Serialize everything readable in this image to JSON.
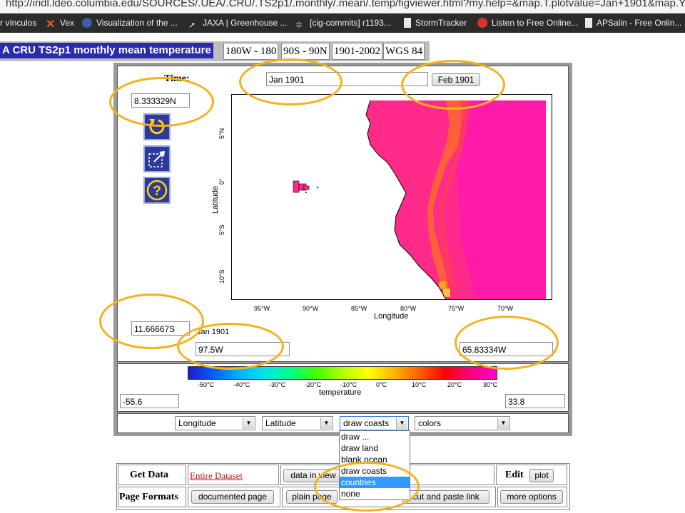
{
  "browser": {
    "url": "http://iridl.ldeo.columbia.edu/SOURCES/.UEA/.CRU/.TS2p1/.monthly/.mean/.temp/figviewer.html?my.help=&map.T.plotvalue=Jan+1901&map.Y",
    "bookmarks": [
      {
        "label": "r vínculos",
        "icon_color": ""
      },
      {
        "label": "Vex",
        "icon_color": "#e25d1b"
      },
      {
        "label": "Visualization of the ...",
        "icon_color": "#3a5ea8"
      },
      {
        "label": "JAXA | Greenhouse ...",
        "icon_color": "#c8c8c8"
      },
      {
        "label": "[cig-commits] r1193...",
        "icon_color": "#8da0c0"
      },
      {
        "label": "StormTracker",
        "icon_color": "#e8e8e8"
      },
      {
        "label": "Listen to Free Online...",
        "icon_color": "#d8322c"
      },
      {
        "label": "APSalin - Free Onlin...",
        "icon_color": "#e8e8e8"
      }
    ]
  },
  "header": {
    "dataset_title": "A CRU TS2p1 monthly mean temperature",
    "cells": [
      "180W - 180",
      "90S - 90N",
      "1901-2002",
      "WGS 84"
    ]
  },
  "viewer": {
    "time_label": "Time:",
    "time_value": "Jan 1901",
    "next_button": "Feb 1901",
    "north_value": "8.333329N",
    "south_value": "11.66667S",
    "west_value": "97.5W",
    "east_value": "65.83334W",
    "small_time": "Jan 1901",
    "icons": [
      "refresh-icon",
      "zoom-icon",
      "help-icon"
    ],
    "map": {
      "y_axis_label": "Latitude",
      "x_axis_label": "Longitude",
      "y_ticks": [
        "5°N",
        "0°",
        "5°S",
        "10°S"
      ],
      "x_ticks": [
        "95°W",
        "90°W",
        "85°W",
        "80°W",
        "75°W",
        "70°W"
      ]
    },
    "colorbar": {
      "ticks": [
        "-50°C",
        "-40°C",
        "-30°C",
        "-20°C",
        "-10°C",
        "0°C",
        "10°C",
        "20°C",
        "30°C"
      ],
      "label": "temperature",
      "min_value": "-55.6",
      "max_value": "33.8",
      "colors": [
        "#1c1cc8",
        "#0060ff",
        "#00b4ff",
        "#00e6e6",
        "#00ff80",
        "#40ff00",
        "#b4ff00",
        "#ffff00",
        "#ffb400",
        "#ff6000",
        "#ff0000",
        "#ff0080",
        "#ff00c8"
      ]
    },
    "controls": {
      "x_select": "Longitude",
      "y_select": "Latitude",
      "coast_select": "draw coasts",
      "color_select": "colors",
      "coast_options": [
        "draw ...",
        "draw land",
        "blank ocean",
        "draw coasts",
        "countries",
        "none"
      ],
      "coast_selected_index": 4
    }
  },
  "bottom": {
    "get_data": "Get Data",
    "entire_dataset": "Entire Dataset",
    "data_in_view": "data in view",
    "edit": "Edit",
    "plot": "plot",
    "page_formats": "Page Formats",
    "documented_page": "documented page",
    "plain_page": "plain page",
    "cut_paste_link": "cut and paste link",
    "more_options": "more options"
  },
  "colors": {
    "annotation": "#f4b11c",
    "map_fill": "#ff2a8a",
    "title_bg": "#2b2bb0",
    "dropdown_highlight": "#3399ff"
  }
}
